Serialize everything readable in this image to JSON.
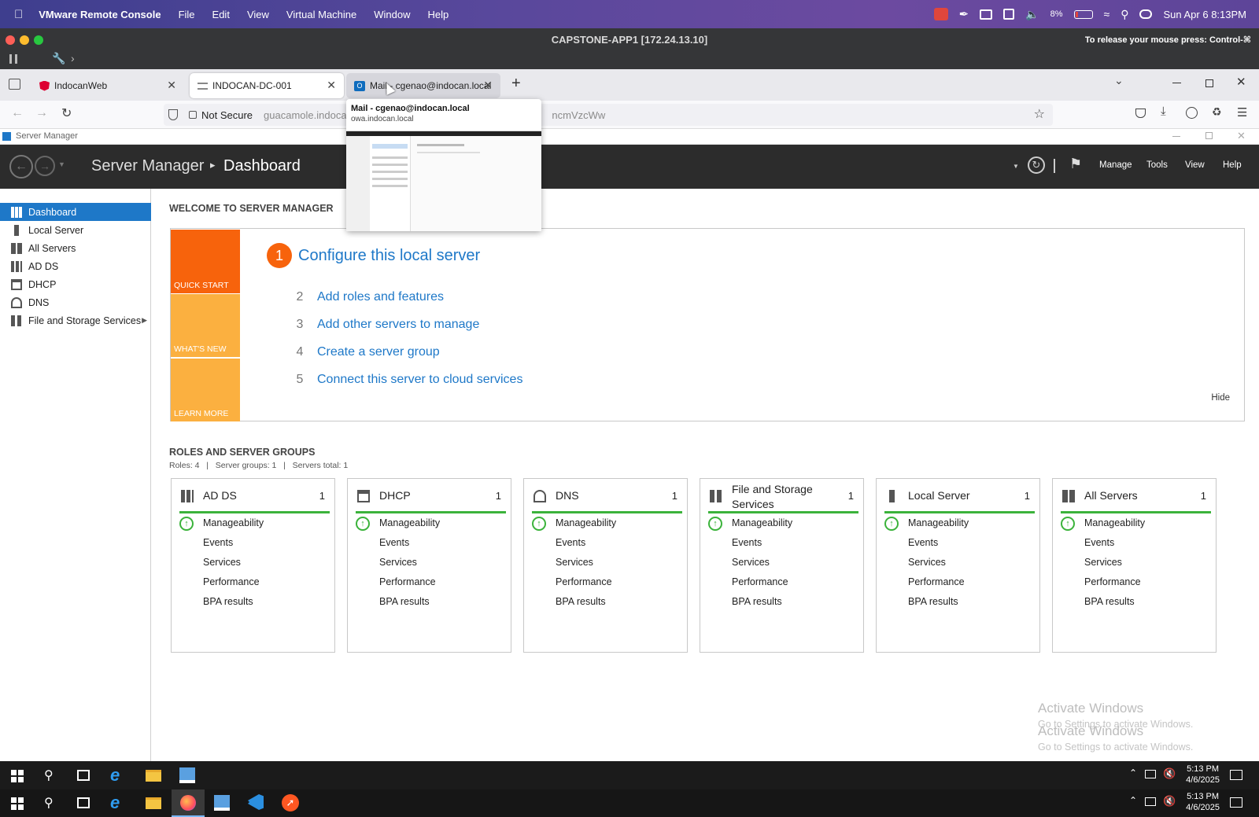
{
  "mac": {
    "app": "VMware Remote Console",
    "menus": [
      "File",
      "Edit",
      "View",
      "Virtual Machine",
      "Window",
      "Help"
    ],
    "battery": "8%",
    "datetime": "Sun Apr 6  8:13PM"
  },
  "vm": {
    "title": "CAPSTONE-APP1 [172.24.13.10]",
    "release_hint": "To release your mouse press: Control-⌘"
  },
  "browser": {
    "tabs": [
      {
        "label": "IndocanWeb"
      },
      {
        "label": "INDOCAN-DC-001"
      },
      {
        "label": "Mail - cgenao@indocan.local"
      }
    ],
    "not_secure": "Not Secure",
    "url_left": "guacamole.indocan.",
    "url_right": "ncmVzcWw",
    "preview_title": "Mail - cgenao@indocan.local",
    "preview_url": "owa.indocan.local"
  },
  "server_manager": {
    "window_title": "Server Manager",
    "breadcrumb_app": "Server Manager",
    "breadcrumb_sep": "▸",
    "breadcrumb_page": "Dashboard",
    "menu": [
      "Manage",
      "Tools",
      "View",
      "Help"
    ],
    "sidebar": [
      {
        "label": "Dashboard"
      },
      {
        "label": "Local Server"
      },
      {
        "label": "All Servers"
      },
      {
        "label": "AD DS"
      },
      {
        "label": "DHCP"
      },
      {
        "label": "DNS"
      },
      {
        "label": "File and Storage Services"
      }
    ],
    "welcome_heading": "WELCOME TO SERVER MANAGER",
    "tiles": [
      "QUICK START",
      "WHAT'S NEW",
      "LEARN MORE"
    ],
    "step1_num": "1",
    "step1_label": "Configure this local server",
    "steps": [
      {
        "num": "2",
        "label": "Add roles and features"
      },
      {
        "num": "3",
        "label": "Add other servers to manage"
      },
      {
        "num": "4",
        "label": "Create a server group"
      },
      {
        "num": "5",
        "label": "Connect this server to cloud services"
      }
    ],
    "hide": "Hide",
    "roles_heading": "ROLES AND SERVER GROUPS",
    "roles_summary": "Roles: 4   |   Server groups: 1   |   Servers total: 1",
    "cards": [
      {
        "title": "AD DS",
        "count": "1"
      },
      {
        "title": "DHCP",
        "count": "1"
      },
      {
        "title": "DNS",
        "count": "1"
      },
      {
        "title": "File and Storage Services",
        "count": "1"
      },
      {
        "title": "Local Server",
        "count": "1"
      },
      {
        "title": "All Servers",
        "count": "1"
      }
    ],
    "card_rows": [
      "Manageability",
      "Events",
      "Services",
      "Performance",
      "BPA results"
    ],
    "watermark_title": "Activate Windows",
    "watermark_sub": "Go to Settings to activate Windows."
  },
  "taskbar": {
    "time": "5:13 PM",
    "date": "4/6/2025"
  }
}
